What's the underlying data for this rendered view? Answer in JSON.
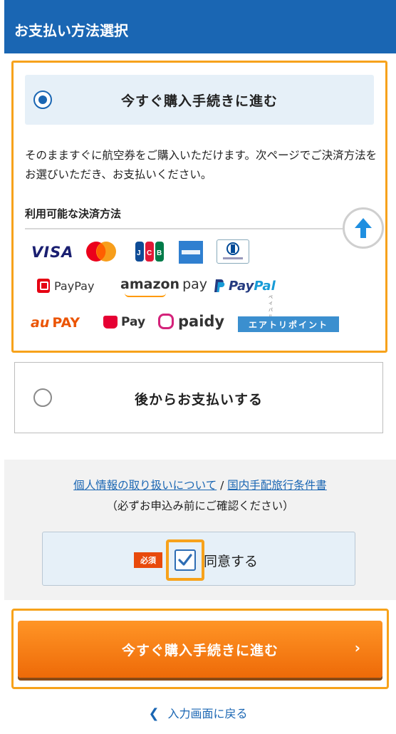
{
  "header": {
    "title": "お支払い方法選択"
  },
  "option_now": {
    "title": "今すぐ購入手続きに進む",
    "selected": true,
    "description": "そのまますぐに航空券をご購入いただけます。次ページでご決済方法をお選びいただき、お支払いください。",
    "methods_title": "利用可能な決済方法",
    "methods": {
      "visa": "VISA",
      "jcb": "JCB",
      "amex": "AMERICAN EXPRESS",
      "diners": "Diners Club",
      "paypay": "PayPay",
      "amazonpay_brand": "amazon",
      "amazonpay_suffix": "pay",
      "paypal_a": "Pay",
      "paypal_b": "Pal",
      "paypal_sub": "ペイパル",
      "aupay_au": "au",
      "aupay_pay": "PAY",
      "merpay": "Pay",
      "paidy": "paidy",
      "airtrip": "エアトリポイント"
    }
  },
  "option_later": {
    "title": "後からお支払いする",
    "selected": false
  },
  "terms": {
    "link_privacy": "個人情報の取り扱いについて",
    "separator": " / ",
    "link_conditions": "国内手配旅行条件書",
    "note": "（必ずお申込み前にご確認ください）",
    "required_badge": "必須",
    "agree_label": "同意する",
    "agree_checked": true
  },
  "cta": {
    "label": "今すぐ購入手続きに進む",
    "arrow": "›"
  },
  "back": {
    "chevron": "❮",
    "label": "入力画面に戻る"
  },
  "colors": {
    "brand_blue": "#1a66b3",
    "highlight_orange": "#f7a21b",
    "cta_orange": "#ee6a08"
  }
}
